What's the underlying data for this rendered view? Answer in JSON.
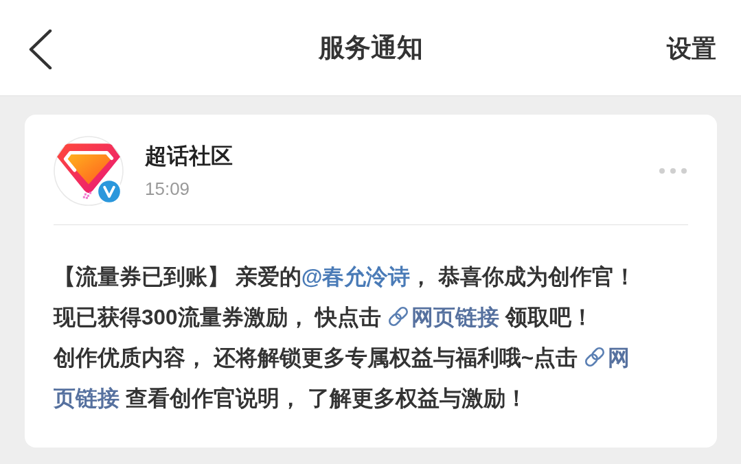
{
  "header": {
    "title": "服务通知",
    "action": "设置"
  },
  "notification": {
    "sender": {
      "name": "超话社区",
      "verified": true
    },
    "time": "15:09",
    "lines": [
      [
        {
          "kind": "text",
          "text": "【流量券已到账】 亲爱的"
        },
        {
          "kind": "mention",
          "text": "@春允泠诗"
        },
        {
          "kind": "text",
          "text": "， 恭喜你成为创作官！"
        }
      ],
      [
        {
          "kind": "text",
          "text": "现已获得300流量券激励， 快点击"
        },
        {
          "kind": "link",
          "text": "网页链接"
        },
        {
          "kind": "text",
          "text": " 领取吧！"
        }
      ],
      [
        {
          "kind": "text",
          "text": "创作优质内容， 还将解锁更多专属权益与福利哦~点击"
        },
        {
          "kind": "link",
          "text": "网"
        }
      ],
      [
        {
          "kind": "link_continued",
          "text": "页链接"
        },
        {
          "kind": "text",
          "text": " 查看创作官说明， 了解更多权益与激励！"
        }
      ]
    ]
  }
}
